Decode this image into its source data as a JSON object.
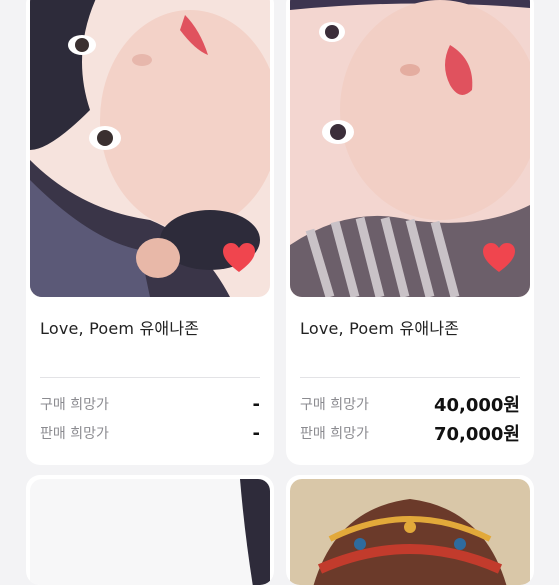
{
  "products": [
    {
      "title": "Love, Poem 유애나존",
      "buy_label": "구매 희망가",
      "buy_price": "-",
      "sell_label": "판매 희망가",
      "sell_price": "-",
      "favorited": true
    },
    {
      "title": "Love, Poem 유애나존",
      "buy_label": "구매 희망가",
      "buy_price": "40,000원",
      "sell_label": "판매 희망가",
      "sell_price": "70,000원",
      "favorited": true
    }
  ],
  "colors": {
    "heart": "#f0454e",
    "card": "#ffffff",
    "background": "#f3f3f5"
  }
}
